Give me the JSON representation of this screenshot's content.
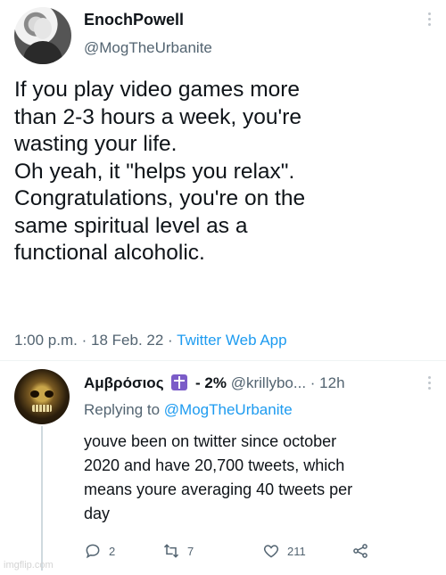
{
  "tweet": {
    "display_name": "EnochPowell",
    "handle": "@MogTheUrbanite",
    "body_lines": [
      "If you play video games more",
      "than 2-3 hours a week, you're",
      "wasting your life.",
      "Oh yeah, it \"helps you relax\".",
      "Congratulations, you're on the",
      "same spiritual level as a",
      "functional alcoholic."
    ],
    "time": "1:00 p.m.",
    "date": "18 Feb. 22",
    "source": "Twitter Web App",
    "dot": "·"
  },
  "reply": {
    "display_name": "Αμβρόσιος",
    "flag_icon": "orthodox-cross-flag-icon",
    "pct": "- 2%",
    "handle": "@krillybo...",
    "time": "· 12h",
    "replying_prefix": "Replying to",
    "replying_to": "@MogTheUrbanite",
    "body_lines": [
      "youve been on twitter since october",
      "2020 and have 20,700 tweets, which",
      "means youre averaging 40 tweets per",
      "day"
    ],
    "counts": {
      "replies": "2",
      "retweets": "7",
      "likes": "211"
    }
  },
  "watermark": "imgflip.com",
  "colors": {
    "link": "#1d9bf0",
    "muted": "#536471",
    "flag": "#7b5cc8"
  }
}
